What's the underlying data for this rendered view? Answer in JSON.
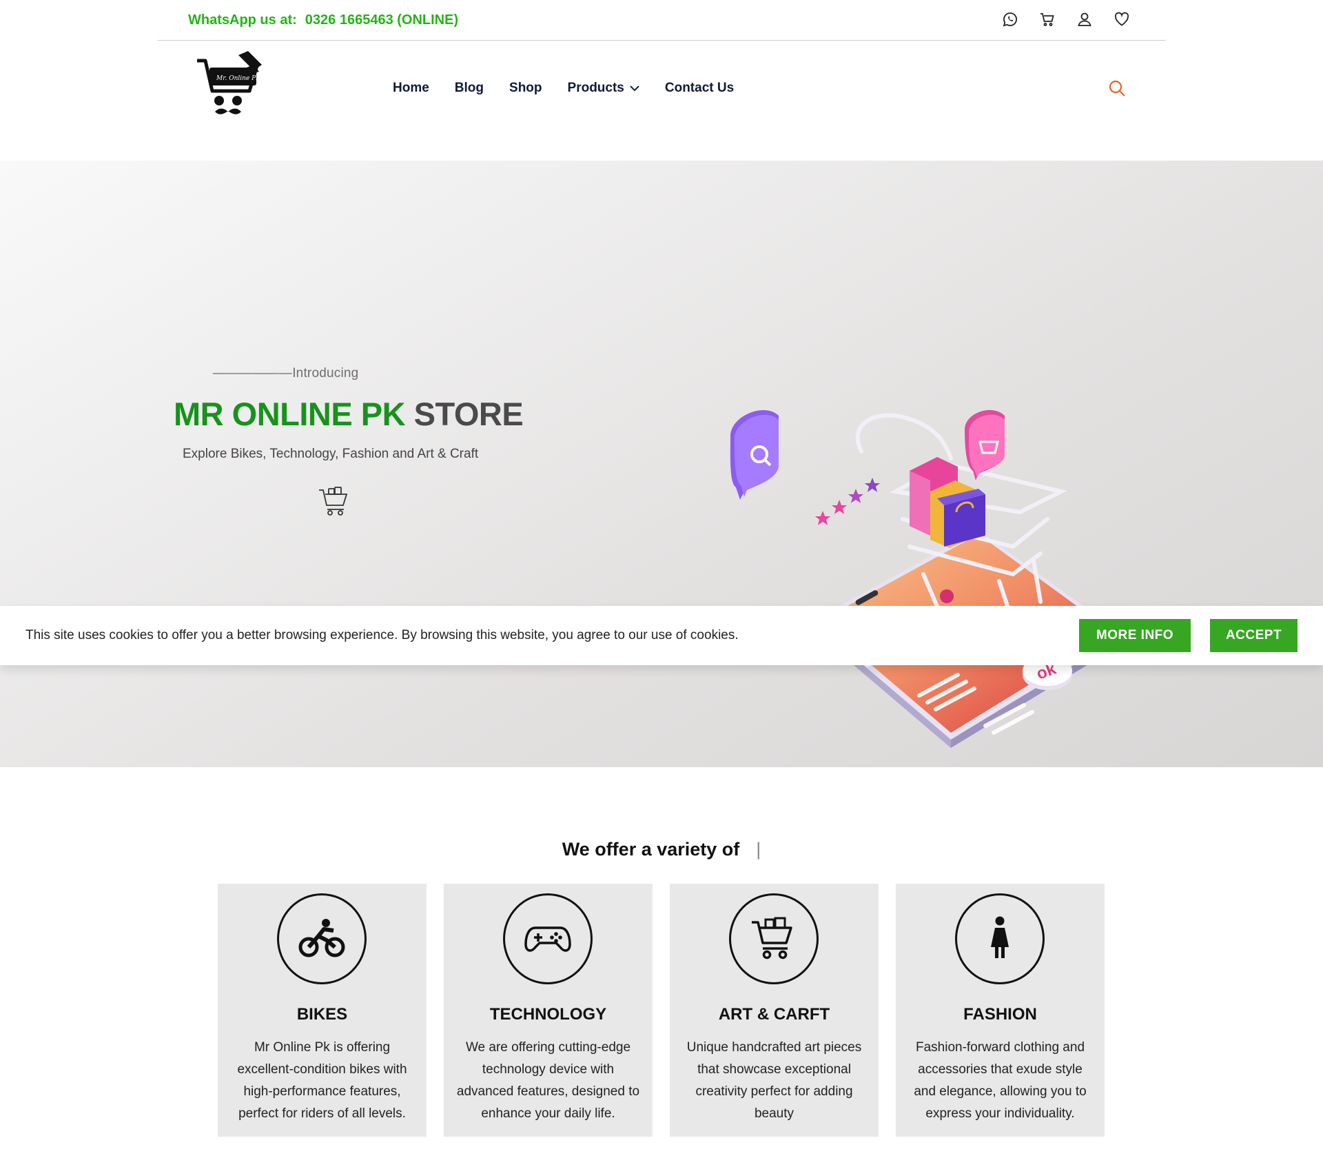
{
  "topbar": {
    "whatsapp_label": "WhatsApp us at:",
    "whatsapp_number": "0326 1665463 (ONLINE)",
    "icons": [
      "whatsapp-icon",
      "cart-icon",
      "user-icon",
      "heart-icon"
    ]
  },
  "header": {
    "logo_text": "Mr. Online Pk",
    "nav": [
      {
        "label": "Home"
      },
      {
        "label": "Blog"
      },
      {
        "label": "Shop"
      },
      {
        "label": "Products"
      },
      {
        "label": "Contact Us"
      }
    ]
  },
  "hero": {
    "intro": "——————Introducing",
    "title_green": "MR ONLINE PK",
    "title_gray": "STORE",
    "subtitle": "Explore Bikes, Technology, Fashion and Art & Craft",
    "illustration_ok": "ok"
  },
  "cookie": {
    "message": "This site uses cookies to offer you a better browsing experience. By browsing this website, you agree to our use of cookies.",
    "more_info": "MORE INFO",
    "accept": "ACCEPT"
  },
  "offer": {
    "title": "We offer a variety of",
    "cursor": "|",
    "cards": [
      {
        "title": "BIKES",
        "text": "Mr Online Pk is offering excellent-condition bikes with high-performance features, perfect for riders of all levels.",
        "icon": "bike-icon"
      },
      {
        "title": "TECHNOLOGY",
        "text": "We are offering cutting-edge technology device with advanced features, designed to enhance your daily life.",
        "icon": "gamepad-icon"
      },
      {
        "title": "ART & CARFT",
        "text": "Unique handcrafted art pieces that showcase exceptional creativity perfect for adding beauty",
        "icon": "basket-cart-icon"
      },
      {
        "title": "FASHION",
        "text": "Fashion-forward clothing and accessories that exude style and elegance, allowing you to express your individuality.",
        "icon": "woman-icon"
      }
    ]
  },
  "colors": {
    "brand_green": "#17921c",
    "whatsapp_green": "#22b514",
    "button_green": "#37a623",
    "search_orange": "#e8622c",
    "nav_navy": "#0e1a3a"
  }
}
